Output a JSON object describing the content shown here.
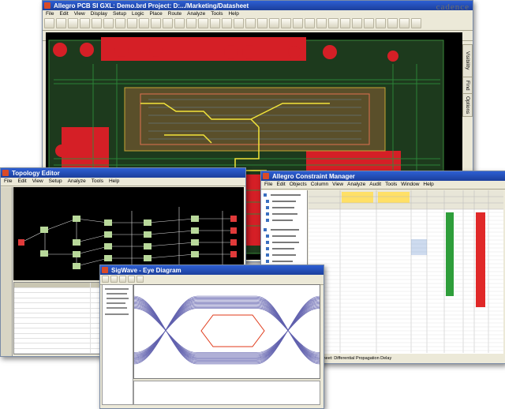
{
  "cad_window": {
    "title": "Allegro PCB SI GXL: Demo.brd  Project: D:.../Marketing/Datasheet",
    "menu": [
      "File",
      "Edit",
      "View",
      "Display",
      "Setup",
      "Logic",
      "Place",
      "Route",
      "Analyze",
      "Tools",
      "Help"
    ],
    "brand": "cadence",
    "side_tabs": [
      "Visibility",
      "Find",
      "Options"
    ],
    "colors": {
      "canvas": "#000000",
      "copper": "#d51f26",
      "trace": "#2e8b3c",
      "highlight": "#f2e43a"
    }
  },
  "schematic_window": {
    "title": "Topology Editor",
    "menu": [
      "File",
      "Edit",
      "View",
      "Setup",
      "Analyze",
      "Tools",
      "Help"
    ],
    "colors": {
      "canvas": "#000000",
      "node": "#b8d89a",
      "wire": "#e0e0e0"
    }
  },
  "constraint_window": {
    "title": "Allegro Constraint Manager",
    "menu": [
      "File",
      "Edit",
      "Objects",
      "Column",
      "View",
      "Analyze",
      "Audit",
      "Tools",
      "Window",
      "Help"
    ],
    "status_text": "Worksheet: Differential Propagation Delay",
    "colors": {
      "pass": "#2e9e3a",
      "fail": "#e02828",
      "header": "#ffe066"
    }
  },
  "eye_window": {
    "title": "SigWave - Eye Diagram",
    "colors": {
      "trace": "#3a3a9a",
      "mask": "#e03a1a"
    }
  }
}
